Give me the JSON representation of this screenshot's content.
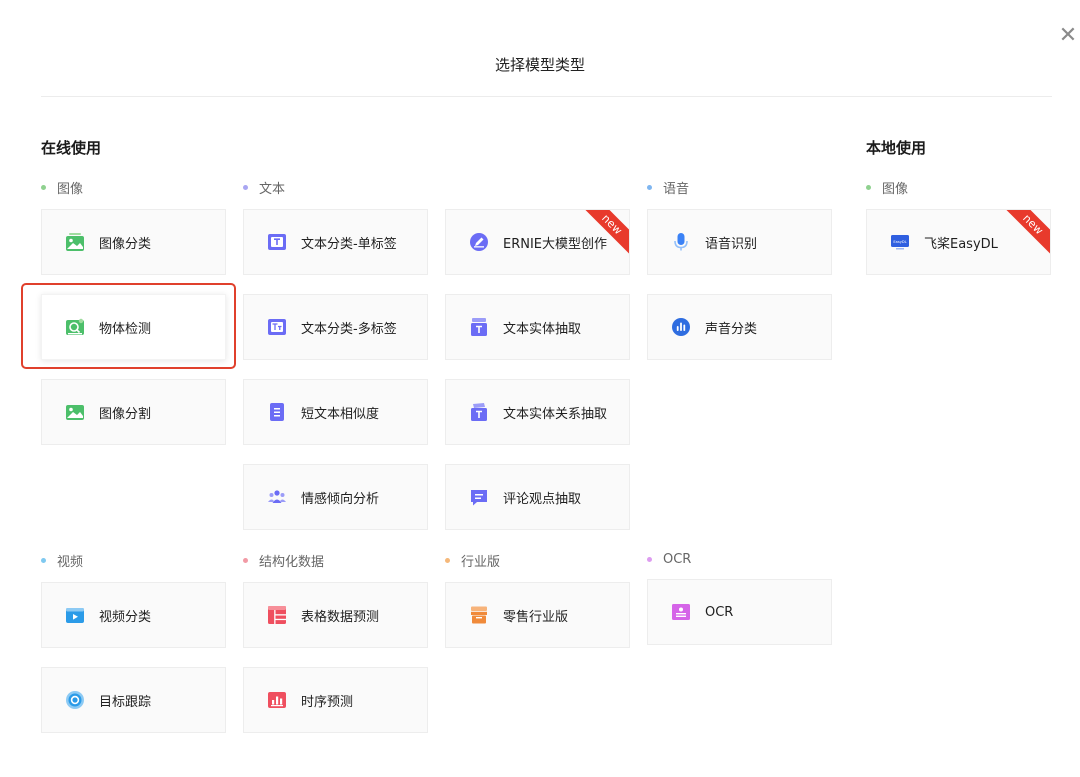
{
  "dialog": {
    "title": "选择模型类型",
    "close_label": "✕"
  },
  "sections": {
    "online": "在线使用",
    "local": "本地使用"
  },
  "categories": {
    "image": "图像",
    "text": "文本",
    "speech": "语音",
    "local_image": "图像",
    "video": "视频",
    "structured": "结构化数据",
    "industry": "行业版",
    "ocr": "OCR"
  },
  "category_colors": {
    "image": "#8fd18f",
    "text": "#a9a6f2",
    "speech": "#7fb6f0",
    "local_image": "#8fd18f",
    "video": "#7fc9f0",
    "structured": "#f29aa5",
    "industry": "#f5b87a",
    "ocr": "#dd9cf0"
  },
  "cards": {
    "image_classification": "图像分类",
    "object_detection": "物体检测",
    "image_segmentation": "图像分割",
    "text_cls_single": "文本分类-单标签",
    "text_cls_multi": "文本分类-多标签",
    "short_text_similarity": "短文本相似度",
    "sentiment": "情感倾向分析",
    "ernie_creation": "ERNIE大模型创作",
    "entity_extraction": "文本实体抽取",
    "entity_relation": "文本实体关系抽取",
    "opinion_extraction": "评论观点抽取",
    "speech_recognition": "语音识别",
    "sound_classification": "声音分类",
    "easydl": "飞桨EasyDL",
    "video_classification": "视频分类",
    "object_tracking": "目标跟踪",
    "table_prediction": "表格数据预测",
    "time_series": "时序预测",
    "retail": "零售行业版",
    "ocr": "OCR"
  },
  "badges": {
    "new": "new",
    "easydl_logo_text": "EasyDL"
  },
  "selected_card": "object_detection",
  "icons": {
    "image_classification": "image-green-icon",
    "object_detection": "detection-green-icon",
    "image_segmentation": "image-green-icon",
    "text_cls_single": "text-t-purple-icon",
    "text_cls_multi": "text-tt-purple-icon",
    "short_text_similarity": "document-purple-icon",
    "sentiment": "people-purple-icon",
    "ernie_creation": "pen-circle-purple-icon",
    "entity_extraction": "text-box-purple-icon",
    "entity_relation": "text-tag-purple-icon",
    "opinion_extraction": "comment-purple-icon",
    "speech_recognition": "microphone-blue-icon",
    "sound_classification": "soundwave-blue-icon",
    "easydl": "easydl-monitor-icon",
    "video_classification": "video-blue-icon",
    "object_tracking": "target-blue-icon",
    "table_prediction": "table-red-icon",
    "time_series": "bar-chart-red-icon",
    "retail": "store-orange-icon",
    "ocr": "ocr-pink-icon"
  }
}
